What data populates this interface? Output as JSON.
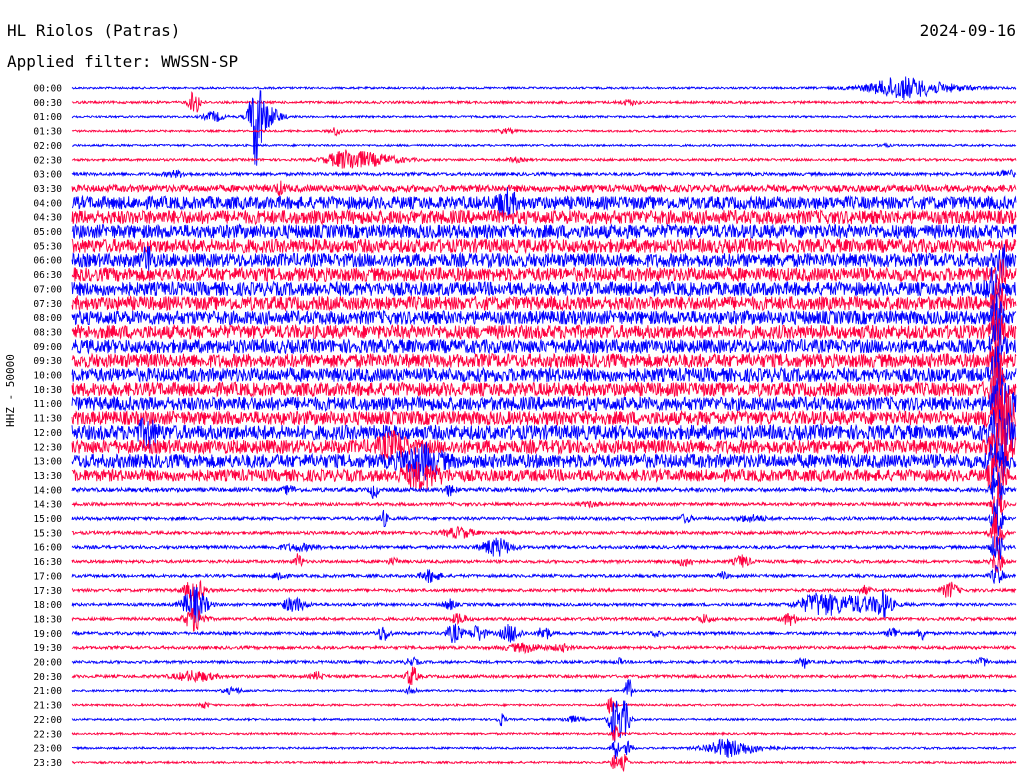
{
  "header": {
    "station": "HL Riolos (Patras)",
    "date": "2024-09-16",
    "filter": "Applied filter: WWSSN-SP"
  },
  "chart_data": {
    "type": "line",
    "title": "HL Riolos (Patras)",
    "ylabel": "HHZ - 50000",
    "colors": [
      "#0000ff",
      "#ff0040"
    ],
    "rows": [
      {
        "time": "00:00",
        "noise": 1.0,
        "events": [
          {
            "x": 0.89,
            "amp": 7,
            "width": 0.05
          },
          {
            "x": 0.875,
            "amp": 5,
            "width": 0.02
          }
        ]
      },
      {
        "time": "00:30",
        "noise": 1.2,
        "events": [
          {
            "x": 0.13,
            "amp": 12,
            "width": 0.006
          },
          {
            "x": 0.59,
            "amp": 2.5,
            "width": 0.01
          }
        ]
      },
      {
        "time": "01:00",
        "noise": 1.0,
        "events": [
          {
            "x": 0.195,
            "amp": 45,
            "width": 0.006
          },
          {
            "x": 0.15,
            "amp": 5,
            "width": 0.01
          },
          {
            "x": 0.205,
            "amp": 12,
            "width": 0.015
          }
        ]
      },
      {
        "time": "01:30",
        "noise": 1.0,
        "events": [
          {
            "x": 0.28,
            "amp": 4,
            "width": 0.006
          },
          {
            "x": 0.46,
            "amp": 2,
            "width": 0.01
          }
        ]
      },
      {
        "time": "02:00",
        "noise": 1.0,
        "events": [
          {
            "x": 0.86,
            "amp": 2,
            "width": 0.005
          }
        ]
      },
      {
        "time": "02:30",
        "noise": 1.2,
        "events": [
          {
            "x": 0.29,
            "amp": 8,
            "width": 0.02
          },
          {
            "x": 0.32,
            "amp": 5,
            "width": 0.03
          },
          {
            "x": 0.47,
            "amp": 2,
            "width": 0.008
          }
        ]
      },
      {
        "time": "03:00",
        "noise": 1.6,
        "events": [
          {
            "x": 0.11,
            "amp": 3,
            "width": 0.01
          },
          {
            "x": 0.99,
            "amp": 4,
            "width": 0.008
          }
        ]
      },
      {
        "time": "03:30",
        "noise": 3.5,
        "events": [
          {
            "x": 0.22,
            "amp": 5,
            "width": 0.005
          }
        ]
      },
      {
        "time": "04:00",
        "noise": 6.5,
        "events": [
          {
            "x": 0.46,
            "amp": 10,
            "width": 0.01
          }
        ]
      },
      {
        "time": "04:30",
        "noise": 7.0,
        "events": []
      },
      {
        "time": "05:00",
        "noise": 7.0,
        "events": []
      },
      {
        "time": "05:30",
        "noise": 7.0,
        "events": []
      },
      {
        "time": "06:00",
        "noise": 7.0,
        "events": [
          {
            "x": 0.08,
            "amp": 14,
            "width": 0.004
          },
          {
            "x": 0.985,
            "amp": 14,
            "width": 0.004
          }
        ]
      },
      {
        "time": "06:30",
        "noise": 7.0,
        "events": [
          {
            "x": 0.985,
            "amp": 16,
            "width": 0.004
          }
        ]
      },
      {
        "time": "07:00",
        "noise": 7.0,
        "events": [
          {
            "x": 0.975,
            "amp": 18,
            "width": 0.006
          }
        ]
      },
      {
        "time": "07:30",
        "noise": 7.0,
        "events": [
          {
            "x": 0.98,
            "amp": 18,
            "width": 0.006
          }
        ]
      },
      {
        "time": "08:00",
        "noise": 7.0,
        "events": [
          {
            "x": 0.98,
            "amp": 20,
            "width": 0.006
          }
        ]
      },
      {
        "time": "08:30",
        "noise": 7.0,
        "events": [
          {
            "x": 0.98,
            "amp": 20,
            "width": 0.006
          }
        ]
      },
      {
        "time": "09:00",
        "noise": 7.0,
        "events": [
          {
            "x": 0.98,
            "amp": 22,
            "width": 0.006
          }
        ]
      },
      {
        "time": "09:30",
        "noise": 7.0,
        "events": [
          {
            "x": 0.98,
            "amp": 22,
            "width": 0.006
          }
        ]
      },
      {
        "time": "10:00",
        "noise": 7.0,
        "events": [
          {
            "x": 0.98,
            "amp": 24,
            "width": 0.006
          }
        ]
      },
      {
        "time": "10:30",
        "noise": 7.0,
        "events": [
          {
            "x": 0.98,
            "amp": 26,
            "width": 0.008
          }
        ]
      },
      {
        "time": "11:00",
        "noise": 7.0,
        "events": [
          {
            "x": 0.985,
            "amp": 28,
            "width": 0.01
          }
        ]
      },
      {
        "time": "11:30",
        "noise": 7.0,
        "events": [
          {
            "x": 0.985,
            "amp": 28,
            "width": 0.012
          }
        ]
      },
      {
        "time": "12:00",
        "noise": 7.5,
        "events": [
          {
            "x": 0.985,
            "amp": 26,
            "width": 0.012
          },
          {
            "x": 0.08,
            "amp": 10,
            "width": 0.01
          }
        ]
      },
      {
        "time": "12:30",
        "noise": 7.0,
        "events": [
          {
            "x": 0.985,
            "amp": 22,
            "width": 0.01
          },
          {
            "x": 0.34,
            "amp": 10,
            "width": 0.015
          }
        ]
      },
      {
        "time": "13:00",
        "noise": 7.0,
        "events": [
          {
            "x": 0.98,
            "amp": 22,
            "width": 0.008
          },
          {
            "x": 0.37,
            "amp": 14,
            "width": 0.02
          }
        ]
      },
      {
        "time": "13:30",
        "noise": 6.0,
        "events": [
          {
            "x": 0.98,
            "amp": 20,
            "width": 0.008
          },
          {
            "x": 0.37,
            "amp": 10,
            "width": 0.02
          }
        ]
      },
      {
        "time": "14:00",
        "noise": 2.0,
        "events": [
          {
            "x": 0.98,
            "amp": 20,
            "width": 0.006
          },
          {
            "x": 0.23,
            "amp": 4,
            "width": 0.006
          },
          {
            "x": 0.4,
            "amp": 5,
            "width": 0.006
          },
          {
            "x": 0.32,
            "amp": 8,
            "width": 0.004
          }
        ]
      },
      {
        "time": "14:30",
        "noise": 1.6,
        "events": [
          {
            "x": 0.98,
            "amp": 20,
            "width": 0.006
          },
          {
            "x": 0.55,
            "amp": 2,
            "width": 0.01
          }
        ]
      },
      {
        "time": "15:00",
        "noise": 1.6,
        "events": [
          {
            "x": 0.98,
            "amp": 20,
            "width": 0.006
          },
          {
            "x": 0.33,
            "amp": 8,
            "width": 0.004
          },
          {
            "x": 0.65,
            "amp": 4,
            "width": 0.006
          },
          {
            "x": 0.72,
            "amp": 3,
            "width": 0.015
          }
        ]
      },
      {
        "time": "15:30",
        "noise": 1.6,
        "events": [
          {
            "x": 0.98,
            "amp": 20,
            "width": 0.006
          },
          {
            "x": 0.41,
            "amp": 5,
            "width": 0.015
          }
        ]
      },
      {
        "time": "16:00",
        "noise": 1.6,
        "events": [
          {
            "x": 0.98,
            "amp": 16,
            "width": 0.006
          },
          {
            "x": 0.45,
            "amp": 9,
            "width": 0.015
          },
          {
            "x": 0.24,
            "amp": 3,
            "width": 0.02
          }
        ]
      },
      {
        "time": "16:30",
        "noise": 1.5,
        "events": [
          {
            "x": 0.98,
            "amp": 12,
            "width": 0.006
          },
          {
            "x": 0.24,
            "amp": 8,
            "width": 0.004
          },
          {
            "x": 0.34,
            "amp": 3,
            "width": 0.006
          },
          {
            "x": 0.65,
            "amp": 4,
            "width": 0.01
          },
          {
            "x": 0.71,
            "amp": 6,
            "width": 0.008
          }
        ]
      },
      {
        "time": "17:00",
        "noise": 1.5,
        "events": [
          {
            "x": 0.98,
            "amp": 10,
            "width": 0.006
          },
          {
            "x": 0.22,
            "amp": 5,
            "width": 0.006
          },
          {
            "x": 0.38,
            "amp": 6,
            "width": 0.01
          },
          {
            "x": 0.69,
            "amp": 4,
            "width": 0.004
          }
        ]
      },
      {
        "time": "17:30",
        "noise": 1.5,
        "events": [
          {
            "x": 0.13,
            "amp": 12,
            "width": 0.01
          },
          {
            "x": 0.93,
            "amp": 8,
            "width": 0.008
          },
          {
            "x": 0.84,
            "amp": 4,
            "width": 0.006
          }
        ]
      },
      {
        "time": "18:00",
        "noise": 1.5,
        "events": [
          {
            "x": 0.13,
            "amp": 18,
            "width": 0.012
          },
          {
            "x": 0.235,
            "amp": 7,
            "width": 0.012
          },
          {
            "x": 0.79,
            "amp": 10,
            "width": 0.02
          },
          {
            "x": 0.83,
            "amp": 8,
            "width": 0.03
          },
          {
            "x": 0.86,
            "amp": 11,
            "width": 0.008
          },
          {
            "x": 0.4,
            "amp": 5,
            "width": 0.006
          }
        ]
      },
      {
        "time": "18:30",
        "noise": 1.5,
        "events": [
          {
            "x": 0.13,
            "amp": 12,
            "width": 0.01
          },
          {
            "x": 0.76,
            "amp": 6,
            "width": 0.008
          },
          {
            "x": 0.67,
            "amp": 4,
            "width": 0.008
          },
          {
            "x": 0.41,
            "amp": 5,
            "width": 0.008
          }
        ]
      },
      {
        "time": "19:00",
        "noise": 1.5,
        "events": [
          {
            "x": 0.33,
            "amp": 8,
            "width": 0.006
          },
          {
            "x": 0.405,
            "amp": 9,
            "width": 0.008
          },
          {
            "x": 0.43,
            "amp": 8,
            "width": 0.008
          },
          {
            "x": 0.465,
            "amp": 9,
            "width": 0.01
          },
          {
            "x": 0.5,
            "amp": 8,
            "width": 0.006
          },
          {
            "x": 0.62,
            "amp": 3,
            "width": 0.006
          },
          {
            "x": 0.87,
            "amp": 6,
            "width": 0.006
          },
          {
            "x": 0.9,
            "amp": 7,
            "width": 0.004
          }
        ]
      },
      {
        "time": "19:30",
        "noise": 1.5,
        "events": [
          {
            "x": 0.48,
            "amp": 4,
            "width": 0.02
          },
          {
            "x": 0.52,
            "amp": 3,
            "width": 0.01
          }
        ]
      },
      {
        "time": "20:00",
        "noise": 1.4,
        "events": [
          {
            "x": 0.775,
            "amp": 6,
            "width": 0.004
          },
          {
            "x": 0.965,
            "amp": 4,
            "width": 0.006
          },
          {
            "x": 0.36,
            "amp": 4,
            "width": 0.006
          },
          {
            "x": 0.58,
            "amp": 3,
            "width": 0.004
          }
        ]
      },
      {
        "time": "20:30",
        "noise": 1.5,
        "events": [
          {
            "x": 0.13,
            "amp": 5,
            "width": 0.02
          },
          {
            "x": 0.36,
            "amp": 10,
            "width": 0.006
          },
          {
            "x": 0.26,
            "amp": 4,
            "width": 0.006
          }
        ]
      },
      {
        "time": "21:00",
        "noise": 1.0,
        "events": [
          {
            "x": 0.17,
            "amp": 3,
            "width": 0.01
          },
          {
            "x": 0.36,
            "amp": 4,
            "width": 0.006
          },
          {
            "x": 0.59,
            "amp": 14,
            "width": 0.004
          }
        ]
      },
      {
        "time": "21:30",
        "noise": 1.0,
        "events": [
          {
            "x": 0.14,
            "amp": 3,
            "width": 0.005
          },
          {
            "x": 0.57,
            "amp": 8,
            "width": 0.004
          }
        ]
      },
      {
        "time": "22:00",
        "noise": 1.0,
        "events": [
          {
            "x": 0.575,
            "amp": 22,
            "width": 0.006
          },
          {
            "x": 0.585,
            "amp": 18,
            "width": 0.006
          },
          {
            "x": 0.455,
            "amp": 6,
            "width": 0.004
          },
          {
            "x": 0.53,
            "amp": 3,
            "width": 0.01
          }
        ]
      },
      {
        "time": "22:30",
        "noise": 1.0,
        "events": [
          {
            "x": 0.575,
            "amp": 8,
            "width": 0.004
          }
        ]
      },
      {
        "time": "23:00",
        "noise": 1.0,
        "events": [
          {
            "x": 0.69,
            "amp": 6,
            "width": 0.02
          },
          {
            "x": 0.71,
            "amp": 4,
            "width": 0.03
          },
          {
            "x": 0.575,
            "amp": 12,
            "width": 0.004
          },
          {
            "x": 0.59,
            "amp": 10,
            "width": 0.004
          }
        ]
      },
      {
        "time": "23:30",
        "noise": 1.0,
        "events": [
          {
            "x": 0.575,
            "amp": 8,
            "width": 0.004
          },
          {
            "x": 0.585,
            "amp": 8,
            "width": 0.004
          }
        ]
      }
    ]
  }
}
